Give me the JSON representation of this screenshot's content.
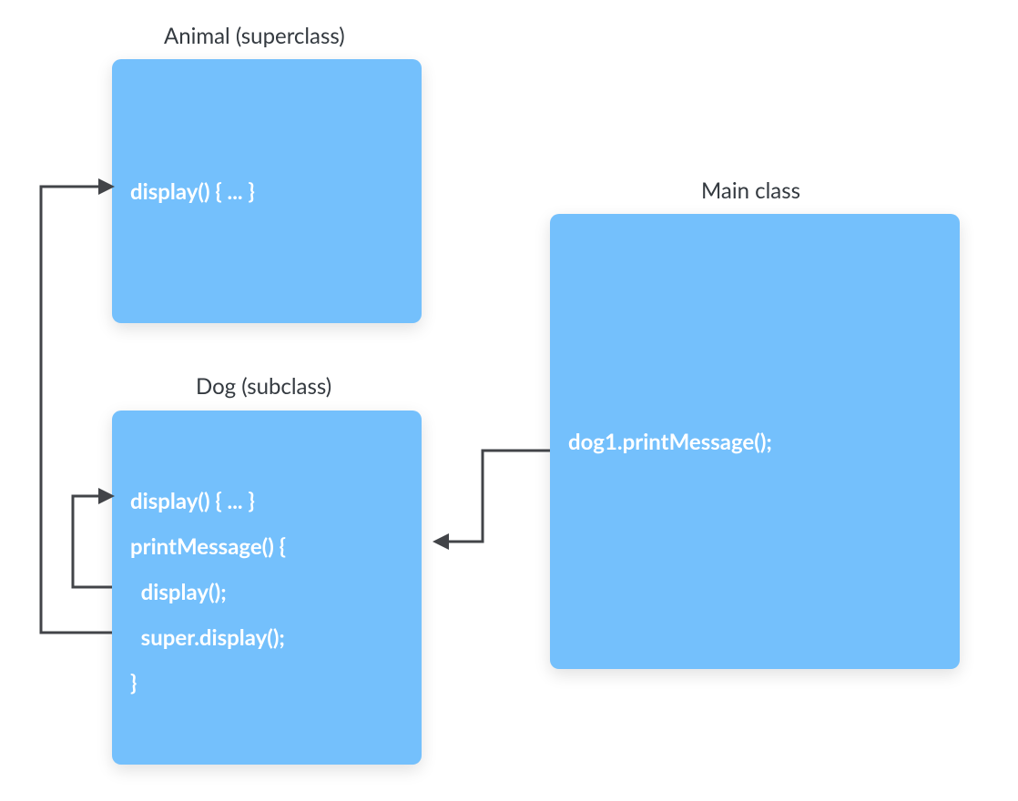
{
  "titles": {
    "animal": "Animal (superclass)",
    "dog": "Dog (subclass)",
    "main": "Main class"
  },
  "animal": {
    "display": "display() { ... }"
  },
  "dog": {
    "display": "display() { ... }",
    "printOpen": "printMessage() {",
    "callDisplay": "  display();",
    "callSuper": "  super.display();",
    "close": "}"
  },
  "main": {
    "code": "dog1.printMessage();"
  },
  "colors": {
    "box": "#74c0fc",
    "arrow": "#424448",
    "text": "#343a40"
  }
}
